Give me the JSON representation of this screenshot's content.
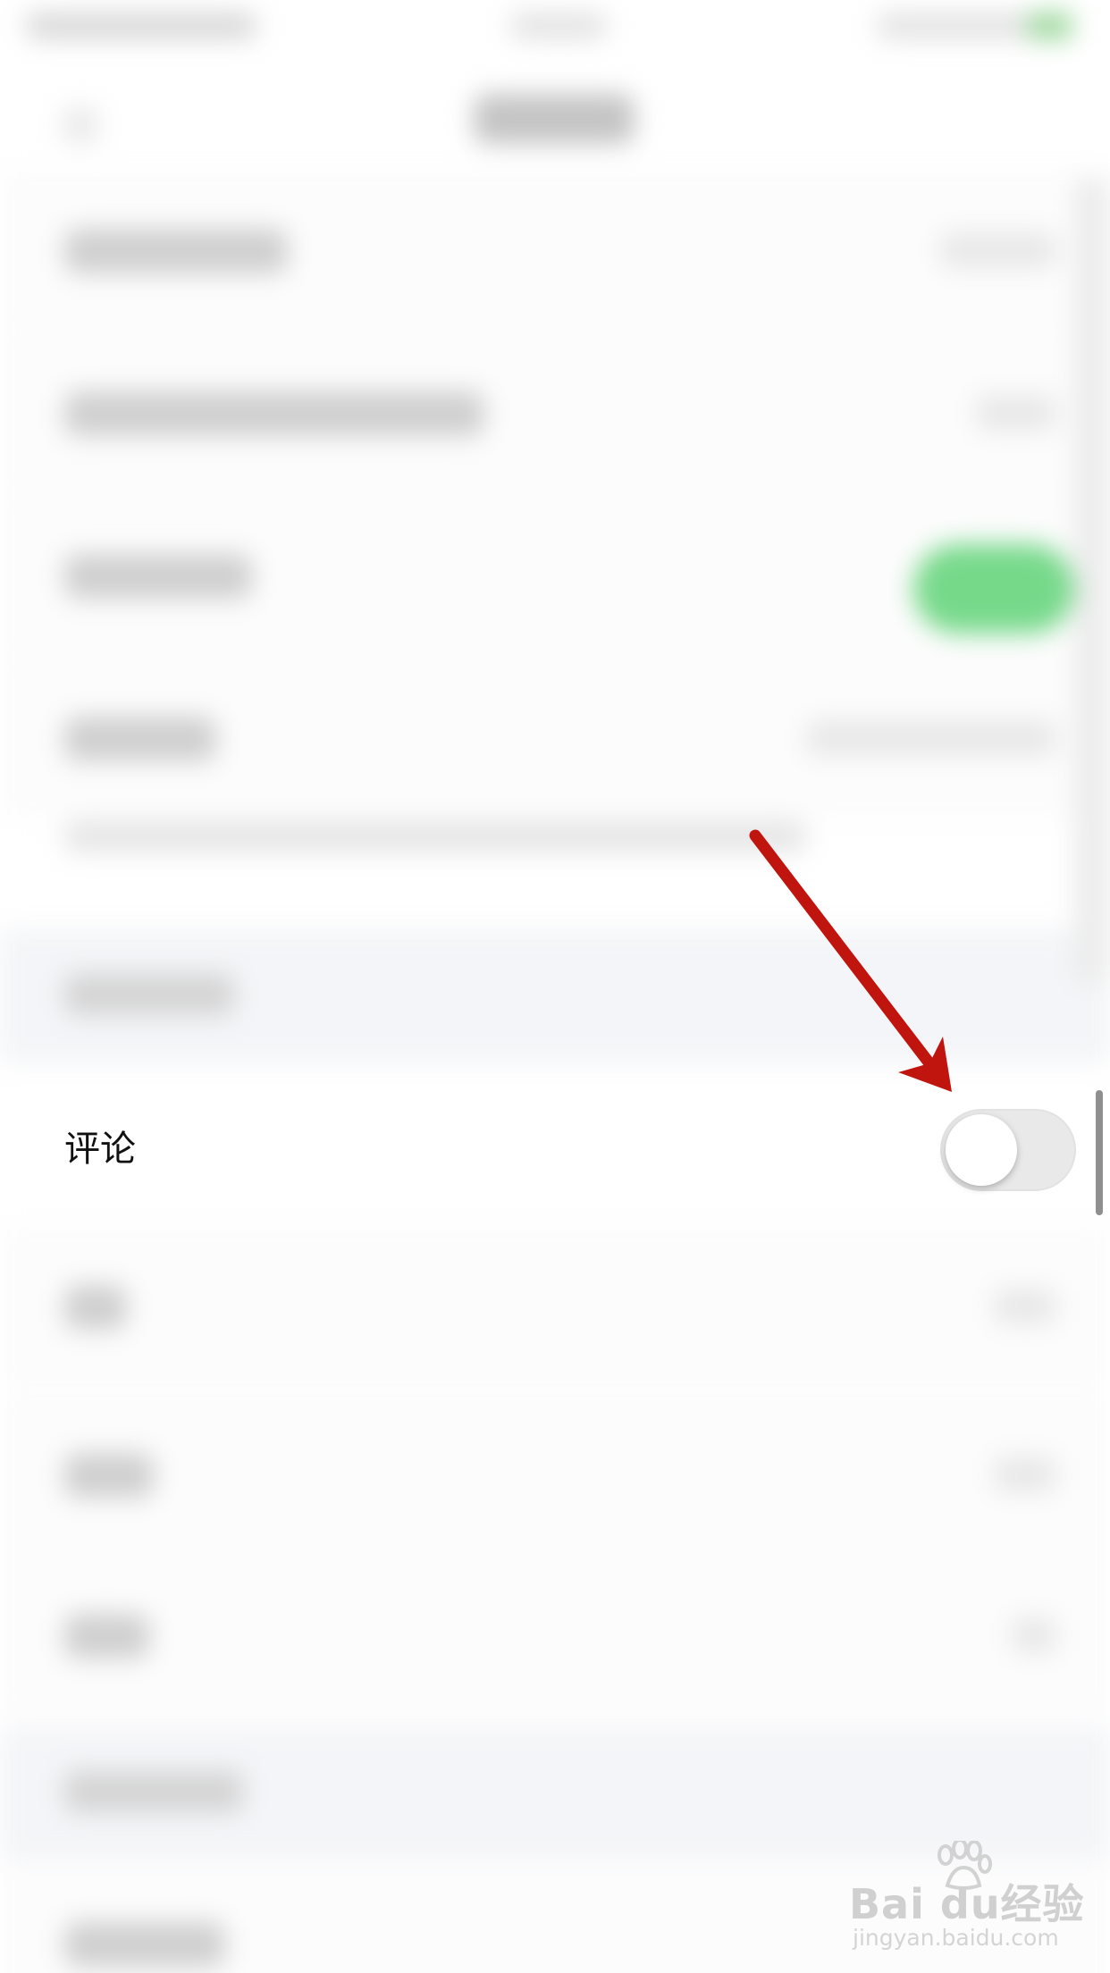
{
  "comment_setting": {
    "label": "评论",
    "toggle_on": false
  },
  "watermark": {
    "brand": "Bai du经验",
    "url": "jingyan.baidu.com"
  },
  "colors": {
    "arrow": "#c0140e",
    "toggle_off_track": "#e9e9ea",
    "toggle_on_track": "#76d98a",
    "section_bg": "#f4f5f8"
  },
  "icons": {
    "annotation": "red-arrow-icon",
    "watermark": "baidu-paw-icon"
  }
}
